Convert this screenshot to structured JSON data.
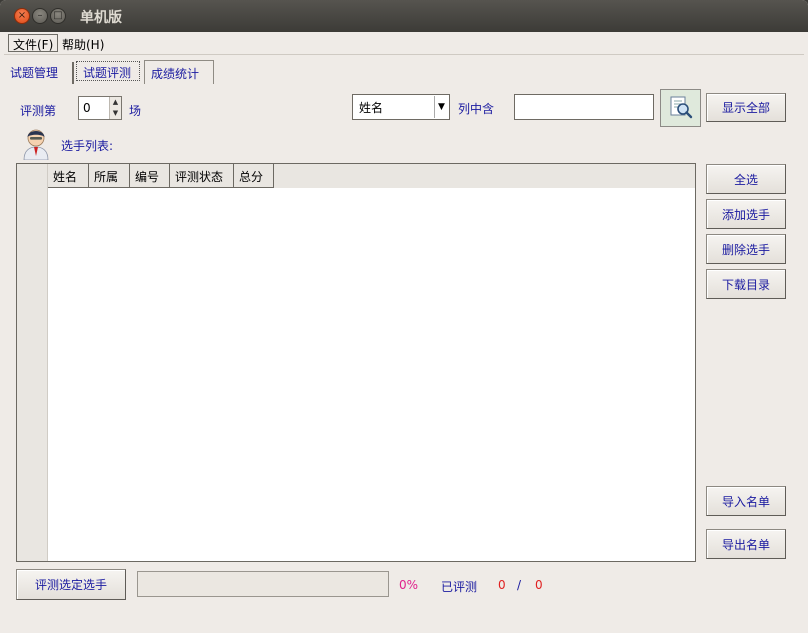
{
  "window": {
    "title": "单机版",
    "close_glyph": "×",
    "min_glyph": "–",
    "max_glyph": "□"
  },
  "menu": {
    "file": "文件(F)",
    "help": "帮助(H)"
  },
  "tabs": [
    {
      "label": "试题管理"
    },
    {
      "label": "试题评测",
      "selected": true
    },
    {
      "label": "成绩统计"
    }
  ],
  "round": {
    "label": "评测第",
    "value": "0",
    "unit": "场"
  },
  "filter": {
    "column": "姓名",
    "contains_label": "列中含",
    "search_value": ""
  },
  "buttons": {
    "show_all": "显示全部",
    "select_all": "全选",
    "add_contestant": "添加选手",
    "delete_contestant": "删除选手",
    "download_dir": "下载目录",
    "import_list": "导入名单",
    "export_list": "导出名单",
    "eval_selected": "评测选定选手"
  },
  "list": {
    "label": "选手列表:",
    "columns": [
      "姓名",
      "所属",
      "编号",
      "评测状态",
      "总分"
    ],
    "rows": []
  },
  "status": {
    "progress": 0,
    "percent": "0%",
    "evaluated_label": "已评测",
    "evaluated": "0",
    "separator": "/",
    "total": "0"
  },
  "icons": {
    "search": "search-icon",
    "avatar": "user-avatar-icon"
  }
}
